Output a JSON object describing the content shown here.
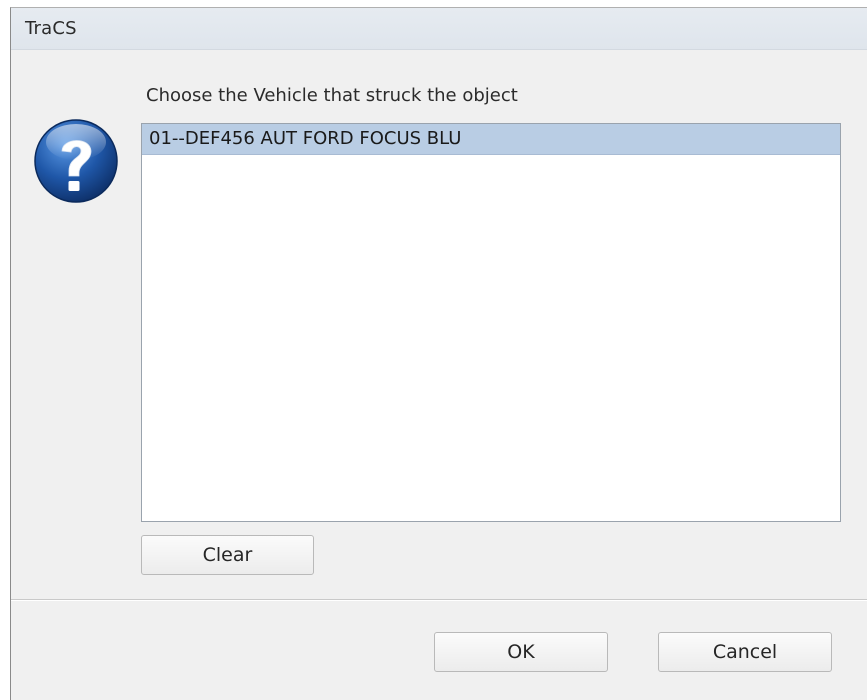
{
  "window": {
    "title": "TraCS"
  },
  "dialog": {
    "prompt": "Choose the Vehicle that struck the object",
    "icon": "question-icon",
    "vehicles": [
      {
        "label": "01--DEF456 AUT FORD FOCUS BLU",
        "selected": true
      }
    ],
    "clear_label": "Clear",
    "ok_label": "OK",
    "cancel_label": "Cancel"
  },
  "colors": {
    "selection": "#b9cde4",
    "titlebar": "#e2e8ef",
    "icon_blue": "#1f57a8"
  }
}
